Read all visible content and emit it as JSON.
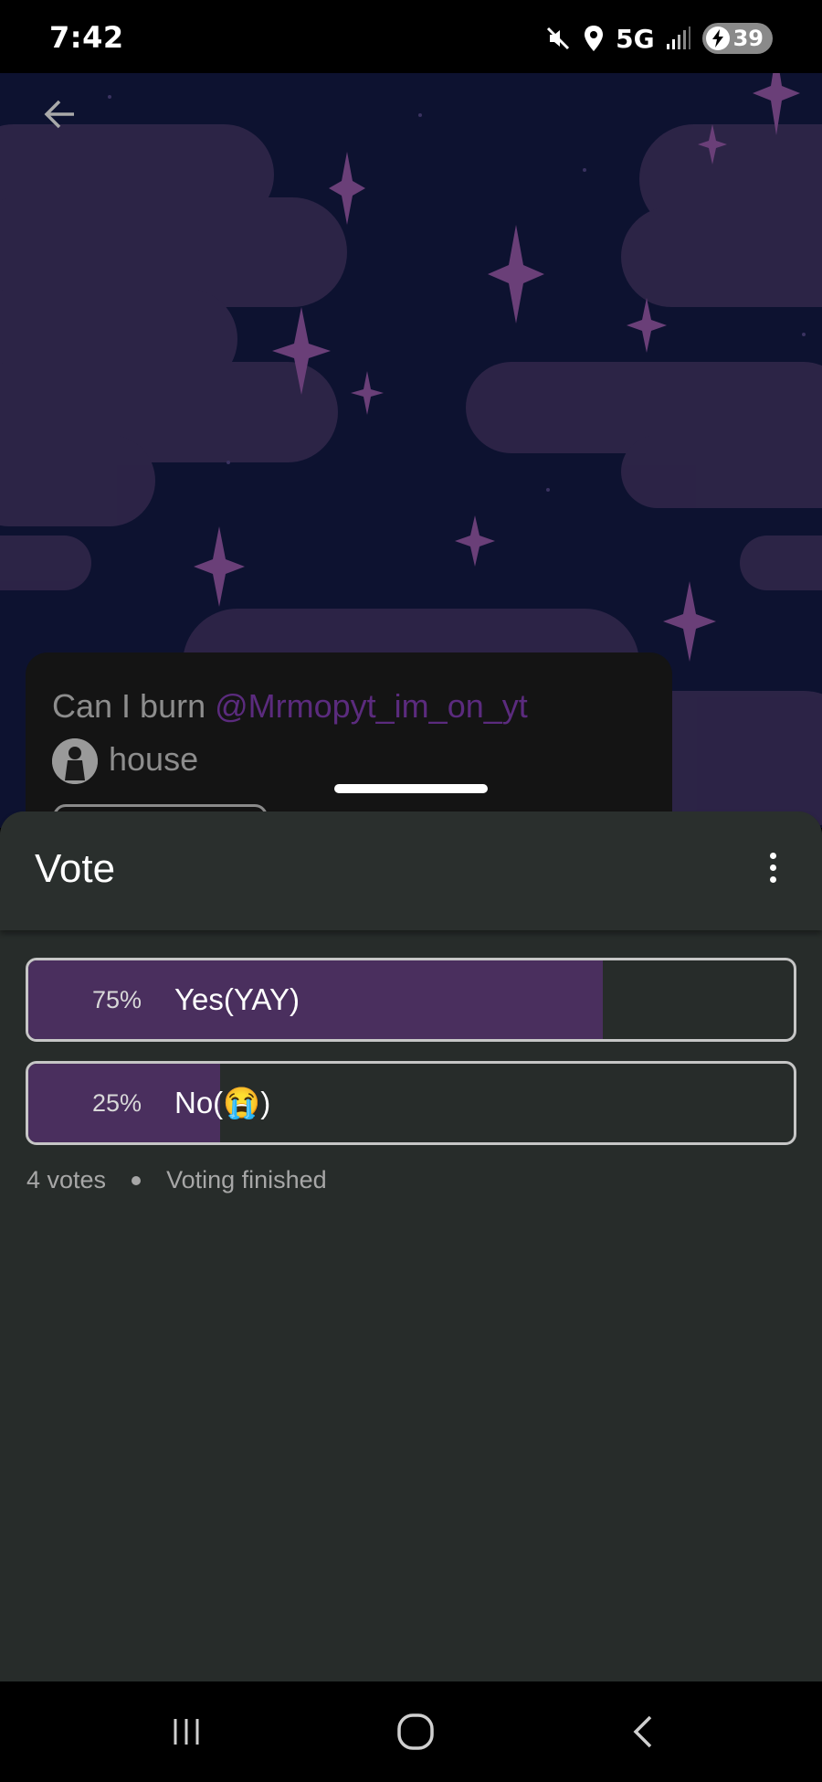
{
  "status_bar": {
    "time": "7:42",
    "network": "5G",
    "battery": "39",
    "icons": [
      "mute-icon",
      "location-icon",
      "signal-icon",
      "charging-icon"
    ]
  },
  "background": {
    "sky_color": "#0d1230",
    "cloud_color": "#2e2548",
    "star_color": "#6a3f78"
  },
  "post": {
    "text_before": "Can I burn ",
    "mention": "@Mrmopyt_im_on_yt",
    "text_after": "house",
    "mention_color": "#5b2b7e"
  },
  "sheet": {
    "title": "Vote",
    "options": [
      {
        "percent_label": "75%",
        "label": "Yes(YAY)",
        "share": 0.75
      },
      {
        "percent_label": "25%",
        "label": "No(😭)",
        "share": 0.25
      }
    ],
    "votes": "4 votes",
    "status": "Voting finished",
    "accent_color": "#4a2f5e"
  },
  "nav_bar": {
    "buttons": [
      "recent-apps-icon",
      "home-icon",
      "back-icon"
    ]
  }
}
